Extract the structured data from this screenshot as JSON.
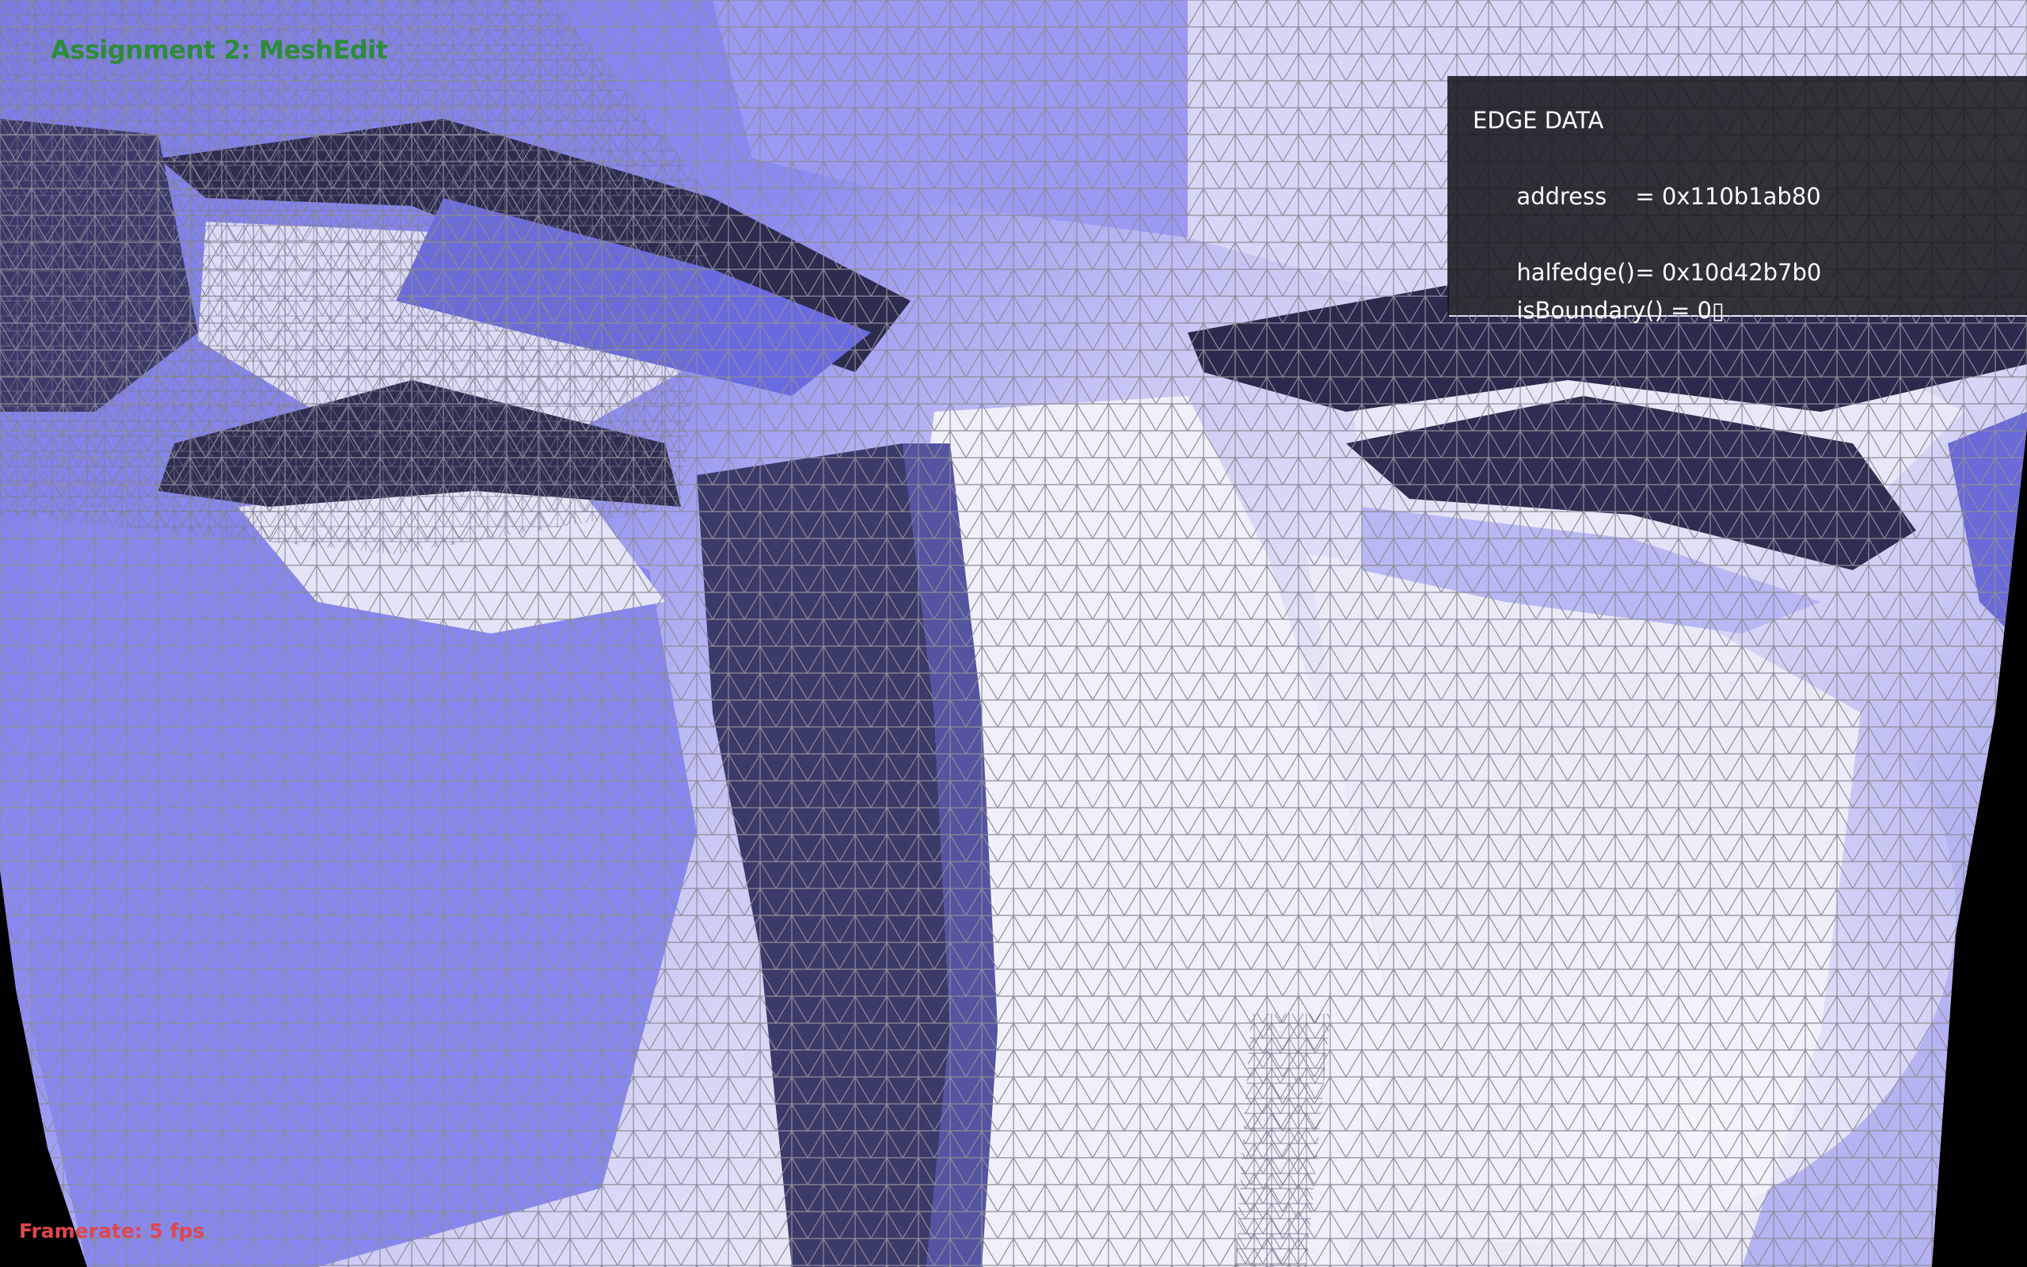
{
  "app": {
    "title": "Assignment 2: MeshEdit",
    "title_color": "#2e8b3a"
  },
  "edge_panel": {
    "heading": "EDGE DATA",
    "address_label": "address",
    "address_value": "= 0x110b1ab80",
    "halfedge_label": "halfedge()",
    "halfedge_value": "= 0x10d42b7b0",
    "boundary_label": "isBoundary()",
    "boundary_value": "= 0▯"
  },
  "status": {
    "framerate_text": "Framerate: 5 fps",
    "framerate_color": "#e0474c"
  },
  "mesh": {
    "description_icon": "triangle-mesh-head",
    "colors": {
      "background": "#000000",
      "light": "#f2f2fa",
      "mid": "#8f8ff2",
      "dark": "#2a2a48",
      "wire": "#9a9a9a"
    }
  }
}
